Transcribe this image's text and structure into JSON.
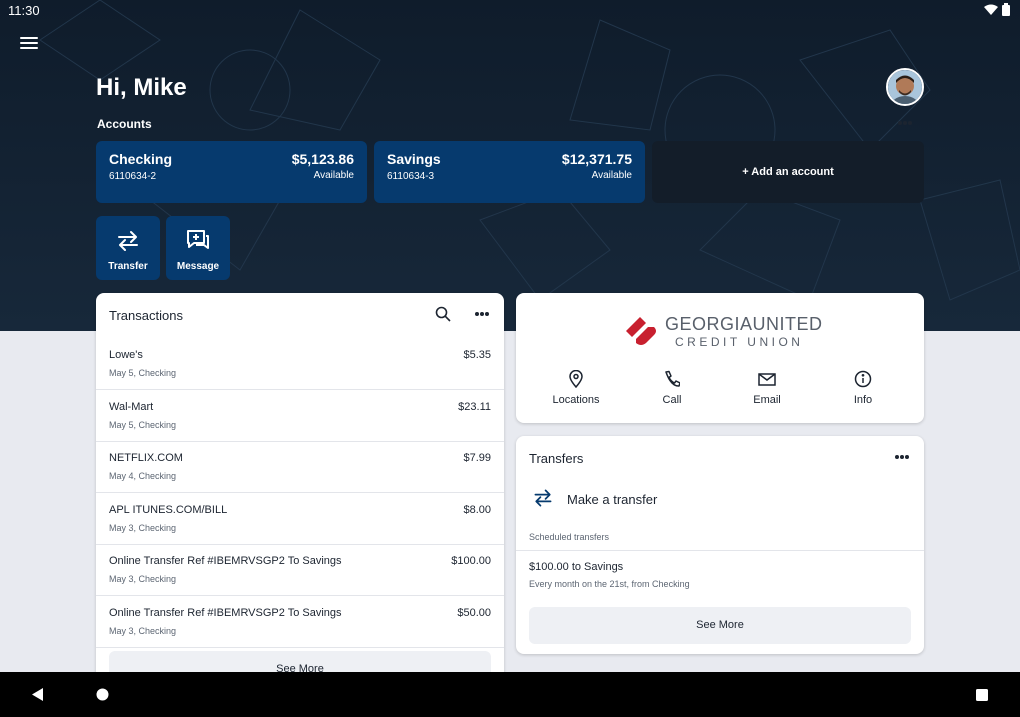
{
  "status_bar": {
    "time": "11:30"
  },
  "greeting": "Hi, Mike",
  "accounts": {
    "label": "Accounts",
    "items": [
      {
        "name": "Checking",
        "number": "6110634-2",
        "balance": "$5,123.86",
        "balance_note": "Available"
      },
      {
        "name": "Savings",
        "number": "6110634-3",
        "balance": "$12,371.75",
        "balance_note": "Available"
      }
    ],
    "add_label": "+ Add an account"
  },
  "actions": [
    {
      "label": "Transfer",
      "icon": "transfer-icon"
    },
    {
      "label": "Message",
      "icon": "message-icon"
    }
  ],
  "transactions": {
    "title": "Transactions",
    "rows": [
      {
        "name": "Lowe's",
        "meta": "May 5, Checking",
        "amount": "$5.35"
      },
      {
        "name": "Wal-Mart",
        "meta": "May 5, Checking",
        "amount": "$23.11"
      },
      {
        "name": "NETFLIX.COM",
        "meta": "May 4, Checking",
        "amount": "$7.99"
      },
      {
        "name": "APL ITUNES.COM/BILL",
        "meta": "May 3, Checking",
        "amount": "$8.00"
      },
      {
        "name": "Online Transfer Ref #IBEMRVSGP2 To Savings",
        "meta": "May 3, Checking",
        "amount": "$100.00"
      },
      {
        "name": "Online Transfer Ref #IBEMRVSGP2 To Savings",
        "meta": "May 3, Checking",
        "amount": "$50.00"
      }
    ],
    "see_more": "See More"
  },
  "credit_union": {
    "logo_line1": "GEORGIAUNITED",
    "logo_line2": "CREDIT UNION",
    "brand_color": "#c8202f",
    "contacts": [
      {
        "label": "Locations",
        "icon": "location-pin-icon"
      },
      {
        "label": "Call",
        "icon": "phone-icon"
      },
      {
        "label": "Email",
        "icon": "email-icon"
      },
      {
        "label": "Info",
        "icon": "info-icon"
      }
    ]
  },
  "transfers": {
    "title": "Transfers",
    "make_transfer": "Make a transfer",
    "scheduled_label": "Scheduled transfers",
    "scheduled": [
      {
        "title": "$100.00 to Savings",
        "detail": "Every month on the 21st, from Checking"
      }
    ],
    "see_more": "See More"
  },
  "colors": {
    "hero_bg": "#142333",
    "account_card": "#063a6e",
    "add_account_bg": "#131d29",
    "page_bg": "#e8eaf0"
  }
}
